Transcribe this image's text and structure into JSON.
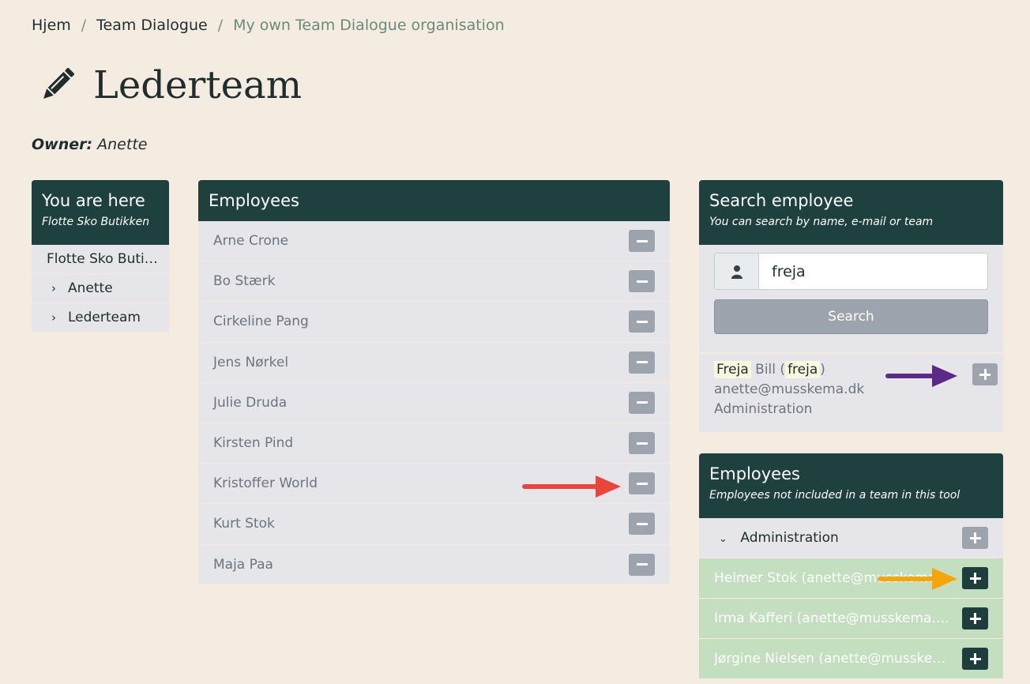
{
  "breadcrumb": {
    "items": [
      "Hjem",
      "Team Dialogue",
      "My own Team Dialogue organisation"
    ],
    "separator": "/"
  },
  "page": {
    "title": "Lederteam",
    "owner_label": "Owner:",
    "owner_name": "Anette"
  },
  "location_panel": {
    "title": "You are here",
    "subtitle": "Flotte Sko Butikken",
    "items": [
      {
        "label": "Flotte Sko Buti…"
      },
      {
        "label": "Anette",
        "chevron": "›"
      },
      {
        "label": "Lederteam",
        "chevron": "›"
      }
    ]
  },
  "employees_panel": {
    "title": "Employees",
    "employees": [
      "Arne Crone",
      "Bo Stærk",
      "Cirkeline Pang",
      "Jens Nørkel",
      "Julie Druda",
      "Kirsten Pind",
      "Kristoffer World",
      "Kurt Stok",
      "Maja Paa"
    ]
  },
  "search_panel": {
    "title": "Search employee",
    "subtitle": "You can search by name, e-mail or team",
    "query": "freja",
    "button_label": "Search",
    "result": {
      "first_name": "Freja",
      "last_name": "Bill",
      "paren_open": "(",
      "username": "freja",
      "paren_close": ")",
      "email": "anette@musskema.dk",
      "team": "Administration"
    }
  },
  "unteamed_panel": {
    "title": "Employees",
    "subtitle": "Employees not included in a team in this tool",
    "group": "Administration",
    "employees": [
      "Helmer Stok (anette@musskema.dk)",
      "Irma Kafferi (anette@musskema.dk)",
      "Jørgine Nielsen (anette@musskema.dk)"
    ]
  },
  "colors": {
    "background": "#f4ece1",
    "panel_header": "#1e4140",
    "row_bg": "#e6e6ea",
    "button_gray": "#9ea4ad",
    "button_dark": "#1e3d3c",
    "green_row": "#c4dfc0",
    "arrow_red": "#e8453c",
    "arrow_purple": "#5b2a86",
    "arrow_orange": "#f5a60d"
  },
  "icons": {
    "title": "pencil-icon",
    "search_addon": "user-icon",
    "remove": "minus-icon",
    "add": "plus-icon"
  }
}
